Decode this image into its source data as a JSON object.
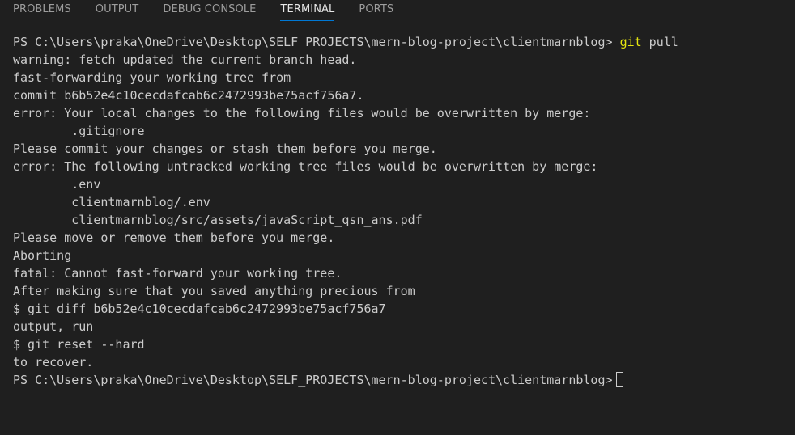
{
  "tabs": [
    {
      "label": "PROBLEMS",
      "active": false
    },
    {
      "label": "OUTPUT",
      "active": false
    },
    {
      "label": "DEBUG CONSOLE",
      "active": false
    },
    {
      "label": "TERMINAL",
      "active": true
    },
    {
      "label": "PORTS",
      "active": false
    }
  ],
  "terminal": {
    "prompt": "PS C:\\Users\\praka\\OneDrive\\Desktop\\SELF_PROJECTS\\mern-blog-project\\clientmarnblog> ",
    "first_command_keyword": "git",
    "first_command_args": " pull",
    "output_lines": [
      "warning: fetch updated the current branch head.",
      "fast-forwarding your working tree from",
      "commit b6b52e4c10cecdafcab6c2472993be75acf756a7.",
      "error: Your local changes to the following files would be overwritten by merge:",
      "        .gitignore",
      "Please commit your changes or stash them before you merge.",
      "error: The following untracked working tree files would be overwritten by merge:",
      "        .env",
      "        clientmarnblog/.env",
      "        clientmarnblog/src/assets/javaScript_qsn_ans.pdf",
      "Please move or remove them before you merge.",
      "Aborting",
      "fatal: Cannot fast-forward your working tree.",
      "After making sure that you saved anything precious from",
      "$ git diff b6b52e4c10cecdafcab6c2472993be75acf756a7",
      "output, run",
      "$ git reset --hard",
      "to recover."
    ],
    "final_prompt": "PS C:\\Users\\praka\\OneDrive\\Desktop\\SELF_PROJECTS\\mern-blog-project\\clientmarnblog>"
  },
  "colors": {
    "background": "#1f1f1f",
    "text": "#cccccc",
    "command": "#e5e510",
    "active_tab_underline": "#0078d4"
  }
}
